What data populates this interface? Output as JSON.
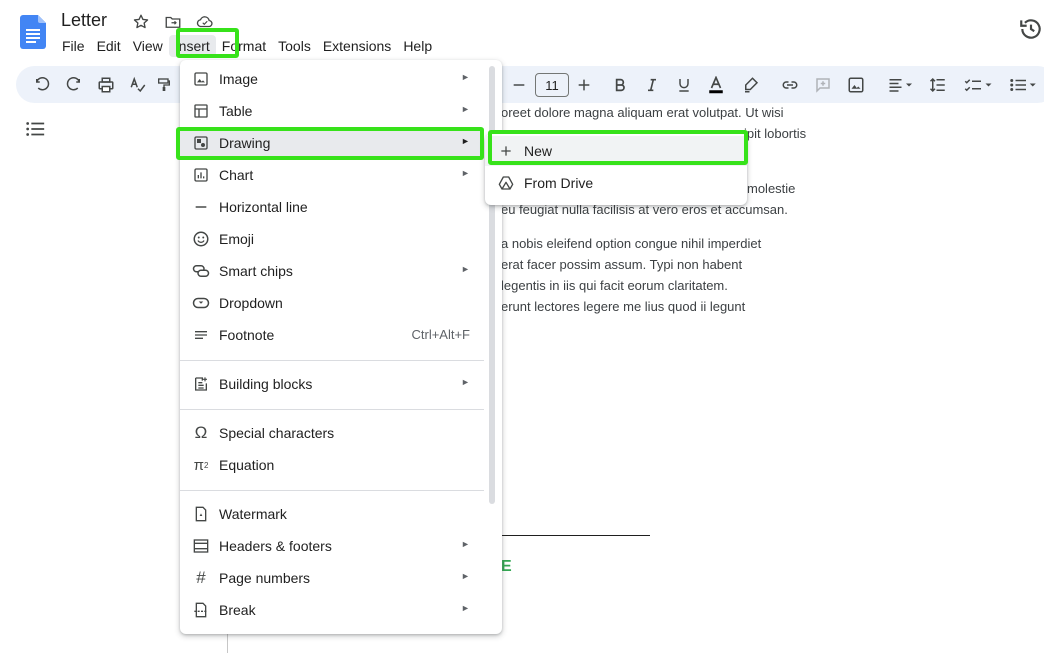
{
  "doc": {
    "title": "Letter"
  },
  "menubar": {
    "items": [
      "File",
      "Edit",
      "View",
      "Insert",
      "Format",
      "Tools",
      "Extensions",
      "Help"
    ],
    "active": "Insert"
  },
  "toolbar": {
    "font_size": "11"
  },
  "document": {
    "lines": [
      "oreet dolore magna aliquam erat volutpat. Ut wisi",
      "ipit lobortis",
      "molestie",
      "eu feugiat nulla facilisis at vero eros et accumsan.",
      "a nobis eleifend option congue nihil imperdiet",
      "erat facer possim assum. Typi non habent",
      "legentis in iis qui facit eorum claritatem.",
      "erunt lectores legere me lius quod ii legunt"
    ],
    "signature_fragment": "E"
  },
  "insert_menu": {
    "items": [
      {
        "label": "Image",
        "icon": "image-icon"
      },
      {
        "label": "Table",
        "icon": "table-icon"
      },
      {
        "label": "Drawing",
        "icon": "drawing-icon"
      },
      {
        "label": "Chart",
        "icon": "chart-icon"
      },
      {
        "label": "Horizontal line",
        "icon": "horizontal-line-icon"
      },
      {
        "label": "Emoji",
        "icon": "emoji-icon"
      },
      {
        "label": "Smart chips",
        "icon": "smart-chips-icon"
      },
      {
        "label": "Dropdown",
        "icon": "dropdown-icon"
      },
      {
        "label": "Footnote",
        "icon": "footnote-icon",
        "shortcut": "Ctrl+Alt+F"
      },
      {
        "label": "Building blocks",
        "icon": "building-blocks-icon"
      },
      {
        "label": "Special characters",
        "icon": "omega-icon"
      },
      {
        "label": "Equation",
        "icon": "pi-icon"
      },
      {
        "label": "Watermark",
        "icon": "watermark-icon"
      },
      {
        "label": "Headers & footers",
        "icon": "headers-footers-icon"
      },
      {
        "label": "Page numbers",
        "icon": "hash-icon"
      },
      {
        "label": "Break",
        "icon": "break-icon"
      }
    ],
    "highlighted": "Drawing"
  },
  "drawing_submenu": {
    "items": [
      {
        "label": "New",
        "icon": "plus-icon"
      },
      {
        "label": "From Drive",
        "icon": "drive-icon"
      }
    ],
    "highlighted": "New"
  },
  "colors": {
    "highlight_box": "#37e21a",
    "toolbar_bg": "#edf2fa",
    "docs_blue": "#4285f4",
    "signature_green": "#34a853"
  }
}
